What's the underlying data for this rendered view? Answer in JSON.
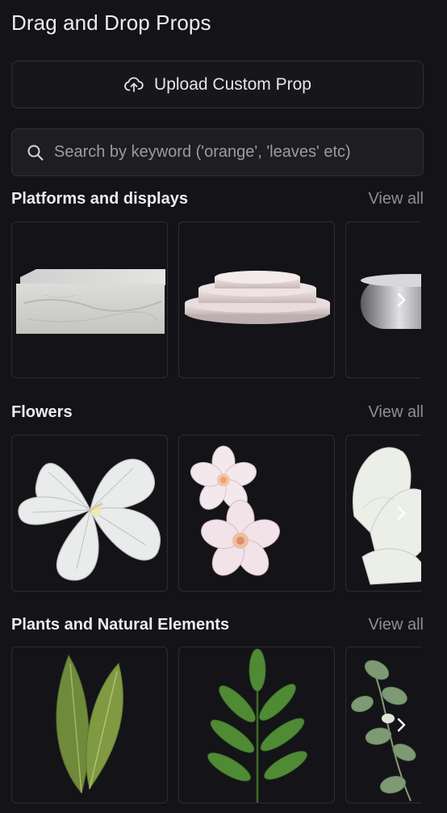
{
  "header": {
    "title": "Drag and Drop Props"
  },
  "upload": {
    "label": "Upload Custom Prop",
    "icon": "cloud-upload-icon"
  },
  "search": {
    "placeholder": "Search by keyword ('orange', 'leaves' etc)",
    "value": "",
    "icon": "search-icon"
  },
  "sections": [
    {
      "title": "Platforms and displays",
      "view_all": "View all",
      "items": [
        "marble-block-platform",
        "round-tiered-pedestal",
        "silver-tray-platform"
      ]
    },
    {
      "title": "Flowers",
      "view_all": "View all",
      "items": [
        "white-hibiscus-flower",
        "cherry-blossom-flowers",
        "white-magnolia-flower"
      ]
    },
    {
      "title": "Plants and Natural Elements",
      "view_all": "View all",
      "items": [
        "green-leaves-pair",
        "fern-branch",
        "eucalyptus-branch"
      ]
    }
  ],
  "colors": {
    "background": "#141418",
    "border": "#2f2f36",
    "muted_text": "#8e8e96"
  }
}
